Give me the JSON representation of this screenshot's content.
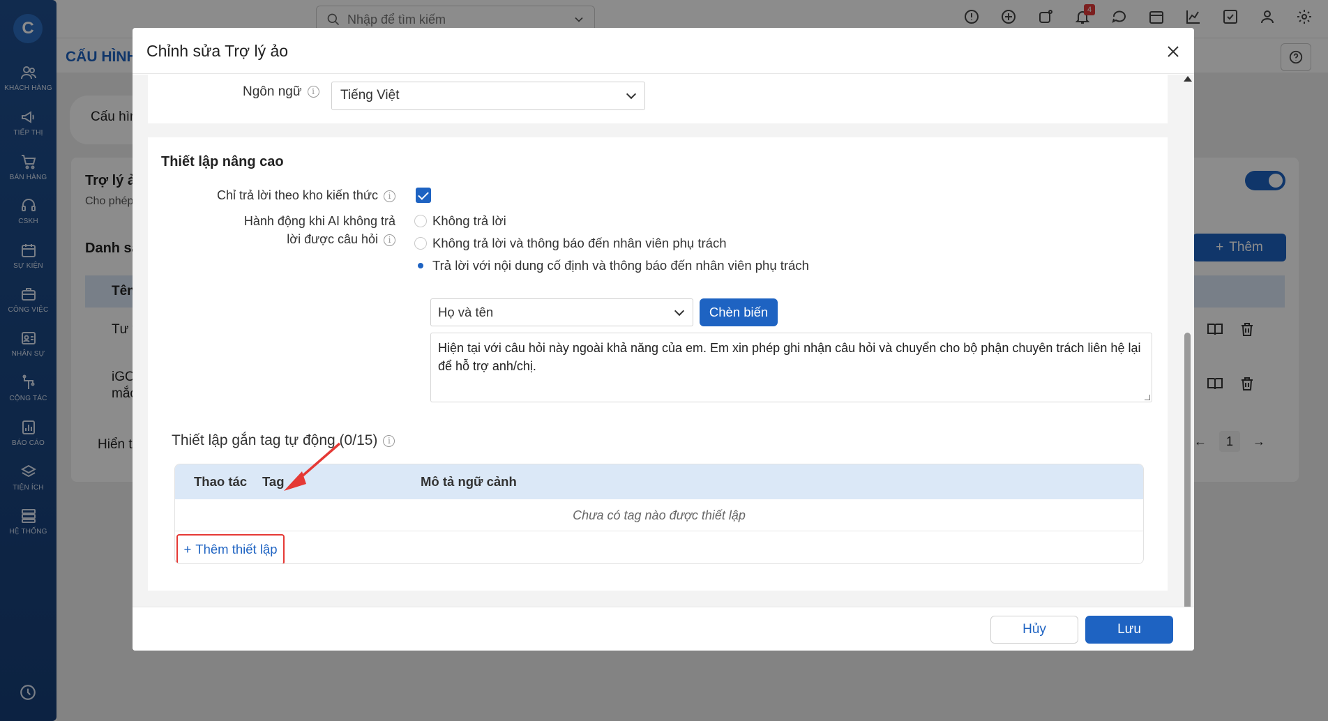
{
  "sidebar": {
    "logo": "C",
    "items": [
      {
        "label": "KHÁCH HÀNG",
        "icon": "users-icon"
      },
      {
        "label": "TIẾP THỊ",
        "icon": "megaphone-icon"
      },
      {
        "label": "BÁN HÀNG",
        "icon": "cart-icon"
      },
      {
        "label": "CSKH",
        "icon": "headset-icon"
      },
      {
        "label": "SỰ KIỆN",
        "icon": "calendar-icon"
      },
      {
        "label": "CÔNG VIỆC",
        "icon": "briefcase-icon"
      },
      {
        "label": "NHÂN SỰ",
        "icon": "id-card-icon"
      },
      {
        "label": "CỘNG TÁC",
        "icon": "collab-icon"
      },
      {
        "label": "BÁO CÁO",
        "icon": "report-icon"
      },
      {
        "label": "TIỆN ÍCH",
        "icon": "layers-icon"
      },
      {
        "label": "HỆ THỐNG",
        "icon": "server-icon"
      }
    ]
  },
  "topbar": {
    "search_placeholder": "Nhập để tìm kiếm",
    "notification_count": "4"
  },
  "background": {
    "page_title": "CẤU HÌNH",
    "tab_label": "Cấu hìn",
    "section_title": "Trợ lý ả",
    "section_desc": "Cho phép",
    "list_title": "Danh sá",
    "add_button": "Thêm",
    "column_name": "Tên",
    "row1": "Tư v",
    "row2a": "iGO",
    "row2b": "mắc",
    "footer_text": "Hiển t",
    "page_number": "1"
  },
  "modal": {
    "title": "Chỉnh sửa Trợ lý ảo",
    "language": {
      "label": "Ngôn ngữ",
      "value": "Tiếng Việt"
    },
    "advanced": {
      "title": "Thiết lập nâng cao",
      "knowledge_only_label": "Chỉ trả lời theo kho kiến thức",
      "knowledge_only_checked": true,
      "fallback_label_line1": "Hành động khi AI không trả",
      "fallback_label_line2": "lời được câu hỏi",
      "fallback_options": [
        {
          "label": "Không trả lời",
          "selected": false
        },
        {
          "label": "Không trả lời và thông báo đến nhân viên phụ trách",
          "selected": false
        },
        {
          "label": "Trả lời với nội dung cố định và thông báo đến nhân viên phụ trách",
          "selected": true
        }
      ],
      "variable_select": "Họ và tên",
      "insert_variable_button": "Chèn biến",
      "fixed_message": "Hiện tại với câu hỏi này ngoài khả năng của em. Em xin phép ghi nhận câu hỏi và chuyển cho bộ phận chuyên trách liên hệ lại để hỗ trợ anh/chị."
    },
    "auto_tag": {
      "title": "Thiết lập gắn tag tự động (0/15)",
      "columns": [
        "Thao tác",
        "Tag",
        "Mô tả ngữ cảnh"
      ],
      "empty_text": "Chưa có tag nào được thiết lập",
      "add_button": "Thêm thiết lập"
    },
    "footer": {
      "cancel": "Hủy",
      "save": "Lưu"
    }
  },
  "colors": {
    "primary": "#1e63c2",
    "sidebar": "#1f4f8f",
    "annotation": "#e53935",
    "table_header": "#dbe8f7"
  }
}
